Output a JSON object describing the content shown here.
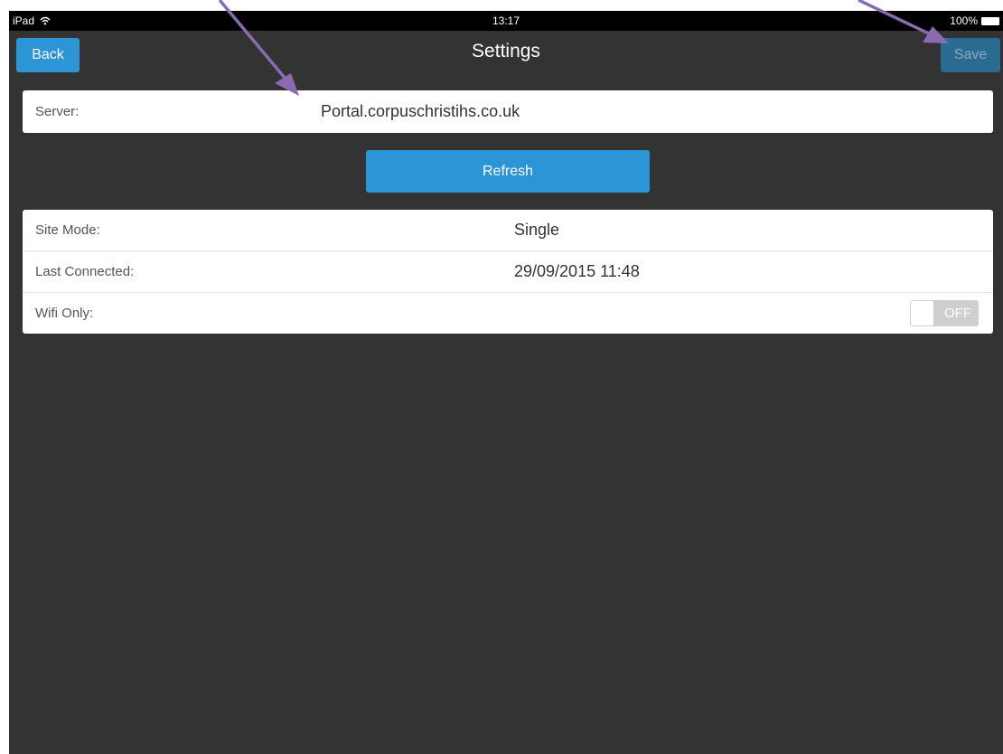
{
  "status_bar": {
    "carrier": "iPad",
    "wifi_icon": "wifi-icon",
    "time": "13:17",
    "battery": "100%",
    "battery_icon": "battery-icon"
  },
  "nav": {
    "title": "Settings",
    "back_label": "Back",
    "save_label": "Save"
  },
  "server": {
    "label": "Server:",
    "value": "Portal.corpuschristihs.co.uk"
  },
  "refresh_label": "Refresh",
  "info": {
    "site_mode_label": "Site Mode:",
    "site_mode_value": "Single",
    "last_connected_label": "Last Connected:",
    "last_connected_value": "29/09/2015 11:48",
    "wifi_only_label": "Wifi Only:",
    "wifi_only_toggle": "OFF"
  },
  "colors": {
    "background": "#333333",
    "accent": "#2b95d5",
    "save_disabled": "#2a6b92",
    "annotation_arrow": "#8a6bb0"
  }
}
